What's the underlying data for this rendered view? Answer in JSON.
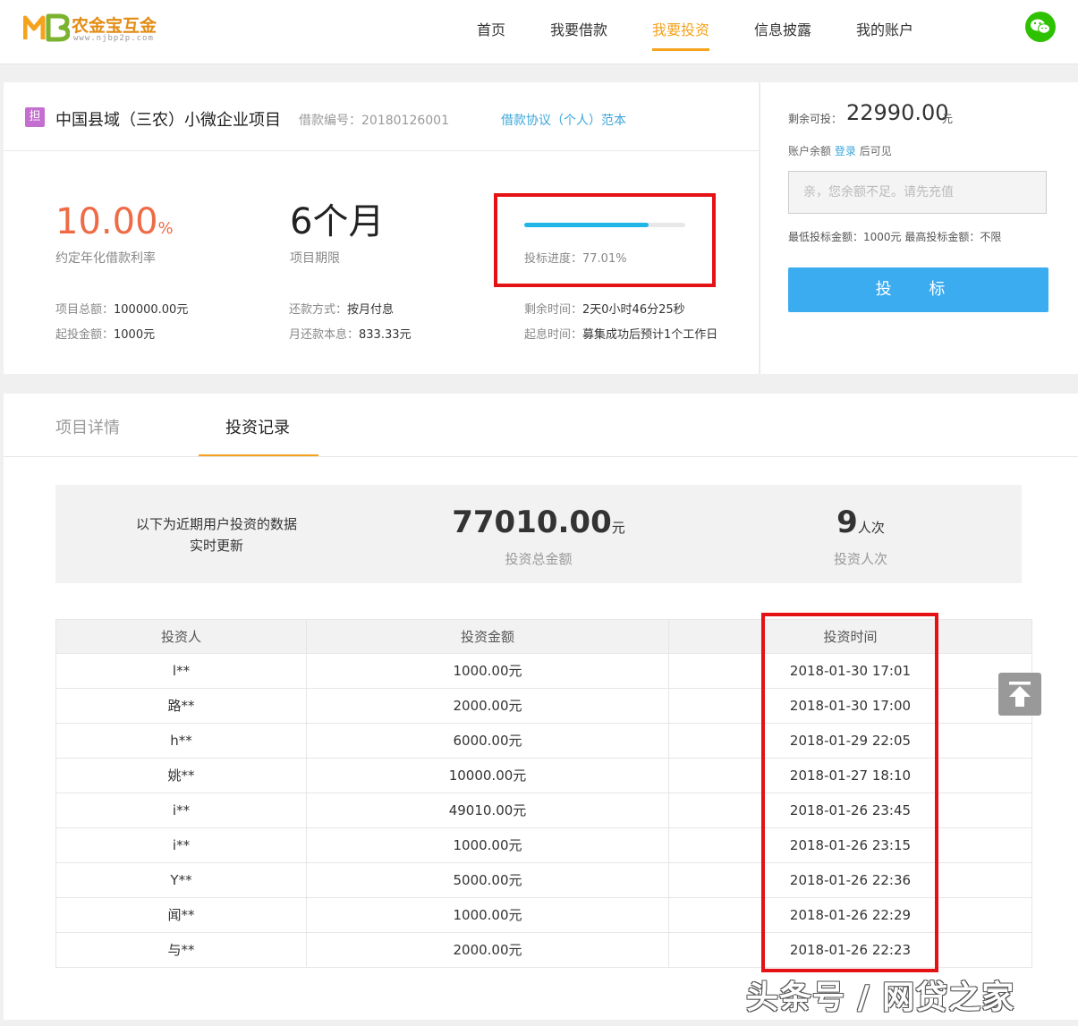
{
  "header": {
    "brand": "农金宝互金",
    "domain": "www.njbp2p.com",
    "nav": [
      "首页",
      "我要借款",
      "我要投资",
      "信息披露",
      "我的账户"
    ],
    "active_nav": "我要投资",
    "wechat_icon": "wechat-icon"
  },
  "project": {
    "badge": "担",
    "title": "中国县域（三农）小微企业项目",
    "loan_no": "借款编号：20180126001",
    "agreement_link": "借款协议（个人）范本",
    "rate_value": "10.00",
    "rate_unit": "%",
    "rate_label": "约定年化借款利率",
    "term_value": "6个月",
    "term_label": "项目期限",
    "progress_percent": 77.01,
    "progress_label": "投标进度：77.01%",
    "total_label": "项目总额：",
    "total_value": "100000.00元",
    "min_label": "起投金额：",
    "min_value": "1000元",
    "repay_label": "还款方式：",
    "repay_value": "按月付息",
    "monthly_label": "月还款本息：",
    "monthly_value": "833.33元",
    "remain_time_label": "剩余时间：",
    "remain_time_value": "2天0小时46分25秒",
    "interest_start_label": "起息时间：",
    "interest_start_value": "募集成功后预计1个工作日"
  },
  "invest_panel": {
    "remain_label": "剩余可投：",
    "remain_value": "22990.00",
    "remain_unit": "元",
    "balance_prefix": "账户余额",
    "login_link": "登录",
    "balance_suffix": "后可见",
    "input_placeholder": "亲，您余额不足。请先充值",
    "limit_text": "最低投标金额：1000元 最高投标金额：不限",
    "invest_button": "投 标"
  },
  "records": {
    "tabs": [
      "项目详情",
      "投资记录"
    ],
    "active_tab": "投资记录",
    "desc_line1": "以下为近期用户投资的数据",
    "desc_line2": "实时更新",
    "total_amount": "77010.00",
    "total_amount_unit": "元",
    "total_amount_label": "投资总金额",
    "count": "9",
    "count_unit": "人次",
    "count_label": "投资人次",
    "columns": [
      "投资人",
      "投资金额",
      "投资时间"
    ],
    "rows": [
      [
        "l**",
        "1000.00元",
        "2018-01-30 17:01"
      ],
      [
        "路**",
        "2000.00元",
        "2018-01-30 17:00"
      ],
      [
        "h**",
        "6000.00元",
        "2018-01-29 22:05"
      ],
      [
        "姚**",
        "10000.00元",
        "2018-01-27 18:10"
      ],
      [
        "i**",
        "49010.00元",
        "2018-01-26 23:45"
      ],
      [
        "i**",
        "1000.00元",
        "2018-01-26 23:15"
      ],
      [
        "Y**",
        "5000.00元",
        "2018-01-26 22:36"
      ],
      [
        "闻**",
        "1000.00元",
        "2018-01-26 22:29"
      ],
      [
        "与**",
        "2000.00元",
        "2018-01-26 22:23"
      ]
    ],
    "back_to_top_icon": "arrow-up-icon"
  },
  "watermark": "头条号 / 网贷之家",
  "colors": {
    "accent": "#f5a21c",
    "rate": "#ee6b46",
    "button": "#3cacf0",
    "progress": "#20b7e8",
    "highlight_box": "#e41115"
  }
}
